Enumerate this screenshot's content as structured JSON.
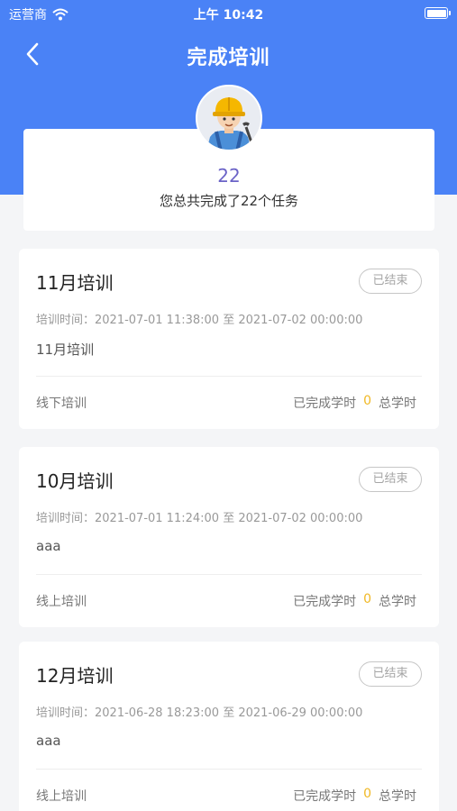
{
  "status_bar": {
    "carrier": "运营商",
    "time": "上午 10:42"
  },
  "nav": {
    "title": "完成培训"
  },
  "summary": {
    "count": "22",
    "text": "您总共完成了22个任务"
  },
  "tasks": [
    {
      "title": "11月培训",
      "status": "已结束",
      "time": "培训时间：2021-07-01 11:38:00 至 2021-07-02 00:00:00",
      "desc": "11月培训",
      "type": "线下培训",
      "done_label": "已完成学时",
      "done_value": "0",
      "total_label": "总学时"
    },
    {
      "title": "10月培训",
      "status": "已结束",
      "time": "培训时间：2021-07-01 11:24:00 至 2021-07-02 00:00:00",
      "desc": "aaa",
      "type": "线上培训",
      "done_label": "已完成学时",
      "done_value": "0",
      "total_label": "总学时"
    },
    {
      "title": "12月培训",
      "status": "已结束",
      "time": "培训时间：2021-06-28 18:23:00 至 2021-06-29 00:00:00",
      "desc": "aaa",
      "type": "线上培训",
      "done_label": "已完成学时",
      "done_value": "0",
      "total_label": "总学时"
    }
  ],
  "colors": {
    "primary": "#4a82f6",
    "count": "#6b63c7",
    "hours_value": "#f0b824",
    "background": "#f4f5f7"
  },
  "icons": {
    "back": "chevron-left-icon",
    "avatar": "worker-avatar-icon",
    "wifi": "wifi-icon",
    "battery": "battery-icon"
  }
}
